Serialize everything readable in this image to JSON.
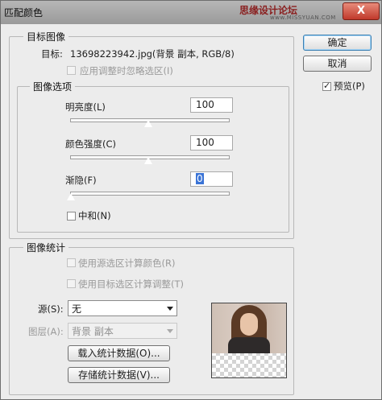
{
  "window": {
    "title": "匹配颜色",
    "watermark": "思缘设计论坛",
    "watermark_sub": "www.MISSYUAN.COM",
    "close_label": "X"
  },
  "target_image": {
    "legend": "目标图像",
    "target_label": "目标:",
    "target_value": "13698223942.jpg(背景 副本, RGB/8)",
    "ignore_selection_label": "应用调整时忽略选区(I)"
  },
  "image_options": {
    "legend": "图像选项",
    "luminance": {
      "label": "明亮度(L)",
      "value": "100",
      "level": 0.5
    },
    "color_intensity": {
      "label": "颜色强度(C)",
      "value": "100",
      "level": 0.5
    },
    "fade": {
      "label": "渐隐(F)",
      "value": "0",
      "level": 0.0
    },
    "neutralize_label": "中和(N)"
  },
  "image_stats": {
    "legend": "图像统计",
    "use_source_selection_label": "使用源选区计算颜色(R)",
    "use_target_selection_label": "使用目标选区计算调整(T)",
    "source_label": "源(S):",
    "source_value": "无",
    "layer_label": "图层(A):",
    "layer_value": "背景 副本",
    "load_stats_label": "载入统计数据(O)...",
    "save_stats_label": "存储统计数据(V)..."
  },
  "buttons": {
    "ok": "确定",
    "cancel": "取消",
    "preview_label": "预览(P)"
  }
}
